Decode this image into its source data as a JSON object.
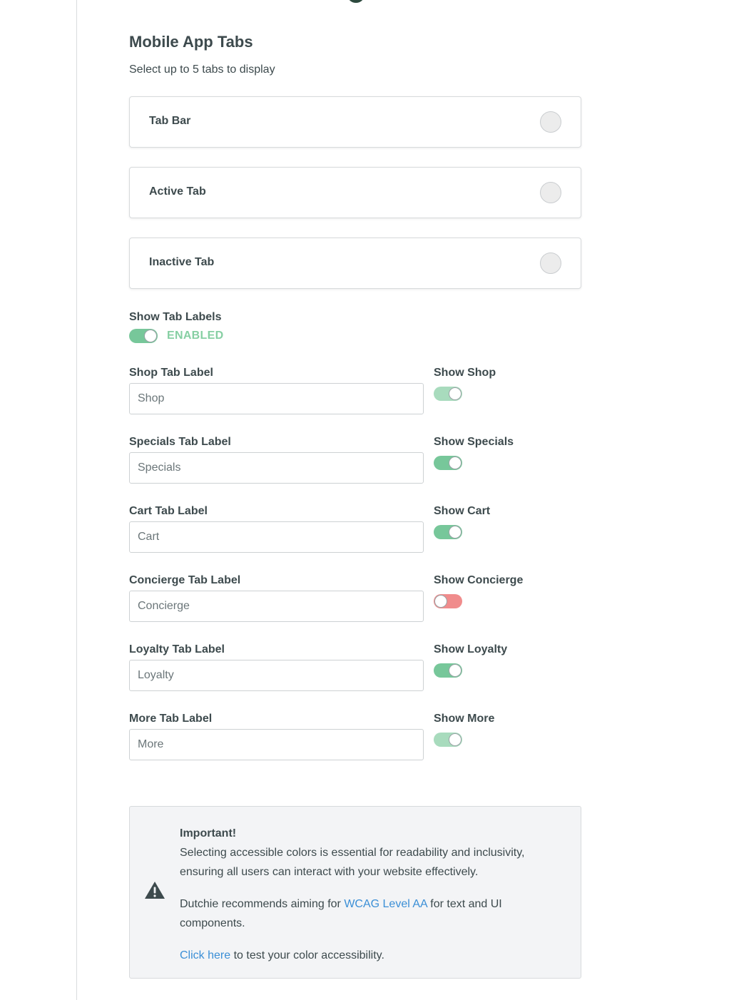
{
  "section": {
    "title": "Mobile App Tabs",
    "subtitle": "Select up to 5 tabs to display"
  },
  "color_rows": [
    {
      "label": "Tab Bar"
    },
    {
      "label": "Active Tab"
    },
    {
      "label": "Inactive Tab"
    }
  ],
  "show_labels": {
    "label": "Show Tab Labels",
    "status": "ENABLED"
  },
  "tabs": [
    {
      "field_label": "Shop Tab Label",
      "value": "Shop",
      "toggle_label": "Show Shop",
      "enabled": true
    },
    {
      "field_label": "Specials Tab Label",
      "value": "Specials",
      "toggle_label": "Show Specials",
      "enabled": true
    },
    {
      "field_label": "Cart Tab Label",
      "value": "Cart",
      "toggle_label": "Show Cart",
      "enabled": true
    },
    {
      "field_label": "Concierge Tab Label",
      "value": "Concierge",
      "toggle_label": "Show Concierge",
      "enabled": false
    },
    {
      "field_label": "Loyalty Tab Label",
      "value": "Loyalty",
      "toggle_label": "Show Loyalty",
      "enabled": true
    },
    {
      "field_label": "More Tab Label",
      "value": "More",
      "toggle_label": "Show More",
      "enabled": true
    }
  ],
  "notice": {
    "title": "Important!",
    "line1": "Selecting accessible colors is essential for readability and inclusivity, ensuring all users can interact with your website effectively.",
    "line2_pre": "Dutchie recommends aiming for ",
    "line2_link": "WCAG Level AA",
    "line2_post": " for text and UI components.",
    "line3_link": "Click here",
    "line3_post": " to test your color accessibility."
  },
  "colors": {
    "toggle_on": "#77c79a",
    "toggle_on_light": "#a8dbbd",
    "toggle_off": "#f08c8c",
    "link": "#3b8fd6",
    "enabled_text": "#86cfa3"
  }
}
